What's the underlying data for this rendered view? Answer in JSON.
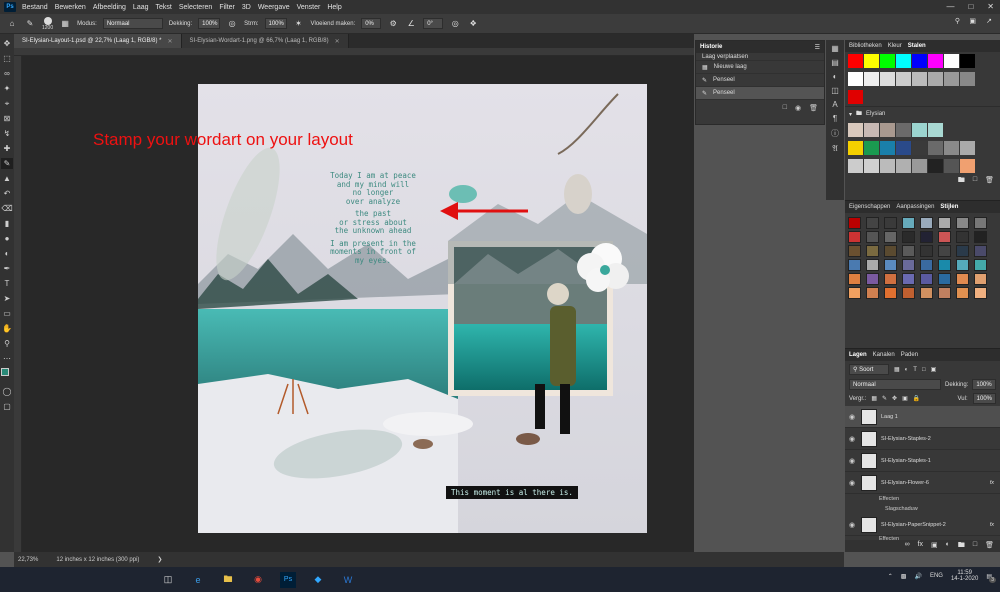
{
  "menubar": {
    "logo": "Ps",
    "items": [
      "Bestand",
      "Bewerken",
      "Afbeelding",
      "Laag",
      "Tekst",
      "Selecteren",
      "Filter",
      "3D",
      "Weergave",
      "Venster",
      "Help"
    ]
  },
  "options": {
    "brush_size": "1200",
    "mode_label": "Modus:",
    "mode_value": "Normaal",
    "opacity_label": "Dekking:",
    "opacity_value": "100%",
    "flow_label": "Strm:",
    "flow_value": "100%",
    "smoothing_label": "Vloeiend maken:",
    "smoothing_value": "0%",
    "angle_value": "0°"
  },
  "tabs": [
    {
      "label": "SI-Elysian-Layout-1.psd @ 22,7% (Laag 1, RGB/8) *"
    },
    {
      "label": "SI-Elysian-Wordart-1.png @ 66,7% (Laag 1, RGB/8)"
    }
  ],
  "annotation": "Stamp your wordart on your layout",
  "journaling": [
    "Today I am at peace",
    "and my mind will",
    "no longer",
    "over analyze",
    "the past",
    "or stress about",
    "the unknown ahead",
    "I am present in the",
    "moments in front of",
    "my eyes."
  ],
  "caption": "This moment is al there is.",
  "status": {
    "zoom": "22,73%",
    "size": "12 inches x 12 inches (300 ppi)"
  },
  "history": {
    "title": "Historie",
    "rows": [
      "Laag verplaatsen",
      "Nieuwe laag",
      "Penseel",
      "Penseel"
    ]
  },
  "swatches_panel": {
    "tabs": [
      "Bibliotheken",
      "Kleur",
      "Stalen"
    ],
    "group": "Elysian",
    "row1": [
      "#ff0000",
      "#ffff00",
      "#00ff00",
      "#00ffff",
      "#0000ff",
      "#ff00ff",
      "#ffffff",
      "#000000"
    ],
    "row2": [
      "#ffffff",
      "#eeeeee",
      "#dddddd",
      "#cccccc",
      "#bbbbbb",
      "#aaaaaa",
      "#999999",
      "#888888"
    ],
    "row3": [
      "#e00000"
    ],
    "elysian1": [
      "#d9c9bd",
      "#c8b9b4",
      "#a9998f",
      "#6b6a6a",
      "#9bd4cf",
      "#a8d8d2"
    ],
    "elysian2": [
      "#f5d000",
      "#1a9a50",
      "#1a7faa",
      "#2a4a8a",
      "#3a3a3a",
      "#6a6a6a",
      "#8a8a8a",
      "#aaaaaa"
    ],
    "elysian3": [
      "#cccccc",
      "#d0d0d0",
      "#bbbbbb",
      "#b0b0b0",
      "#999999",
      "#222222",
      "#555555",
      "#f0a070"
    ]
  },
  "styles_panel": {
    "tabs": [
      "Eigenschappen",
      "Aanpassingen",
      "Stijlen"
    ]
  },
  "layers_panel": {
    "tabs": [
      "Lagen",
      "Kanalen",
      "Paden"
    ],
    "filter": "Soort",
    "blend": "Normaal",
    "opacity_label": "Dekking:",
    "opacity": "100%",
    "lock_label": "Vergr.:",
    "fill_label": "Vul:",
    "fill": "100%",
    "layers": [
      {
        "name": "Laag 1",
        "fx": ""
      },
      {
        "name": "SI-Elysian-Staples-2",
        "fx": ""
      },
      {
        "name": "SI-Elysian-Staples-1",
        "fx": ""
      },
      {
        "name": "SI-Elysian-Flower-6",
        "fx": "fx"
      },
      {
        "name": "SI-Elysian-PaperSnippet-2",
        "fx": "fx"
      }
    ],
    "effects_label": "Effecten",
    "shadow_label": "Slagschaduw",
    "effects_label_2": "Effecten"
  },
  "taskbar": {
    "lang": "ENG",
    "time": "11:59",
    "date": "14-1-2020",
    "badge": "3"
  },
  "colors": {
    "annotation": "#e01010",
    "fg_swatch": "#2a8a78",
    "accent": "#31a8ff"
  }
}
